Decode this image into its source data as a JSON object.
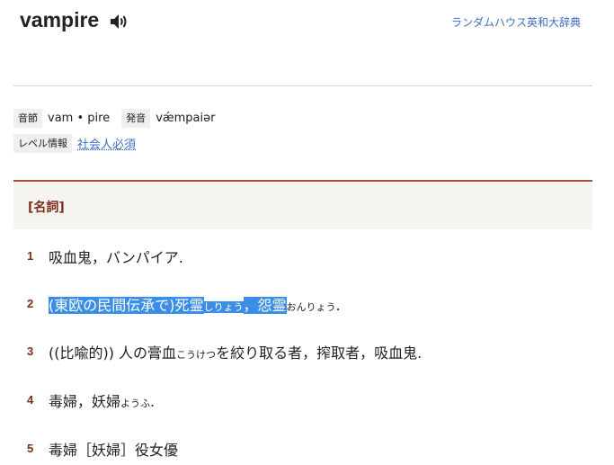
{
  "entry": {
    "headword": "vampire",
    "speaker_icon": "speaker-icon",
    "source_link": "ランダムハウス英和大辞典"
  },
  "meta": {
    "syllable_label": "音節",
    "syllable_value": "vam • pire",
    "pronunciation_label": "発音",
    "pronunciation_value": "vǽmpaiər",
    "level_label": "レベル情報",
    "level_value": "社会人必須"
  },
  "pos": "[名詞]",
  "senses": [
    {
      "num": "1",
      "text": "吸血鬼，バンパイア."
    },
    {
      "num": "2",
      "hl1": "(東欧の民間伝承で)死霊",
      "ruby1": "しりょう",
      "hl2": "，怨霊",
      "ruby2": "おんりょう",
      "tail": "."
    },
    {
      "num": "3",
      "pre": "((比喩的)) 人の膏血",
      "ruby": "こうけつ",
      "post": "を絞り取る者，搾取者，吸血鬼."
    },
    {
      "num": "4",
      "pre": "毒婦，妖婦",
      "ruby": "ようふ",
      "post": "."
    },
    {
      "num": "5",
      "text": "毒婦［妖婦］役女優"
    }
  ],
  "colors": {
    "accent_brown": "#7a2e1b",
    "link_blue": "#3d6ec0",
    "highlight": "#3a8ee6"
  }
}
